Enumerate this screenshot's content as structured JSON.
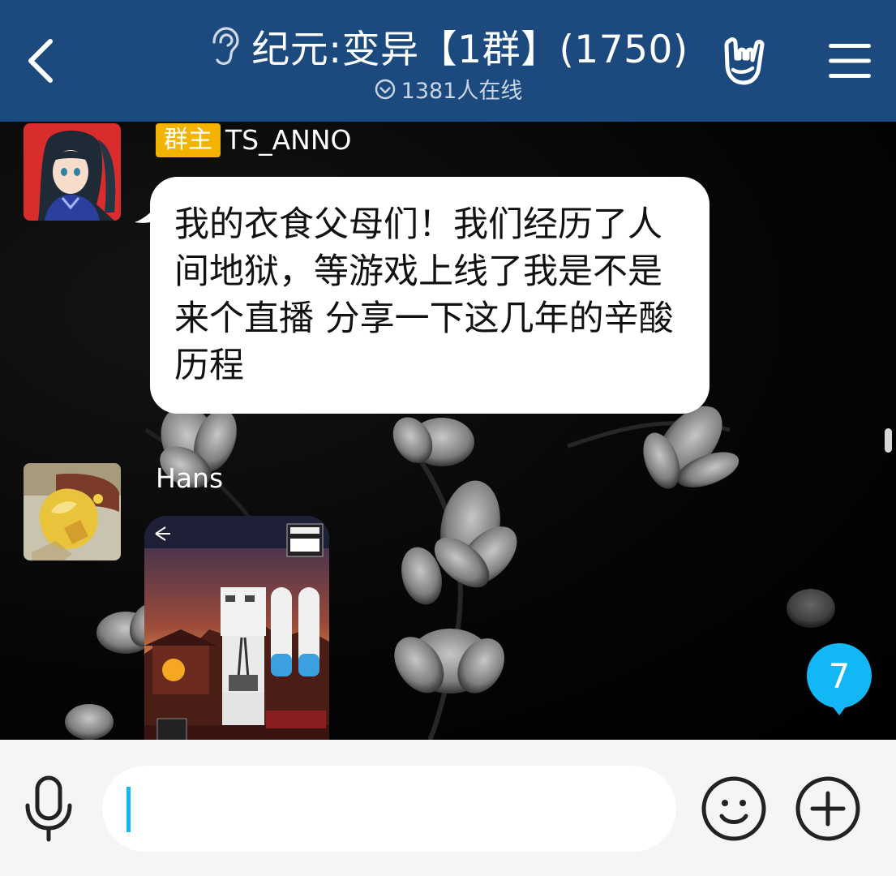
{
  "header": {
    "title": "纪元:变异【1群】(1750)",
    "online_text": "1381人在线",
    "bg_color": "#1c4a7e"
  },
  "messages": [
    {
      "role_badge": "群主",
      "sender": "TS_ANNO",
      "type": "text",
      "text": "我的衣食父母们！我们经历了人间地狱，等游戏上线了我是不是来个直播 分享一下这几年的辛酸历程"
    },
    {
      "sender": "Hans",
      "type": "image"
    }
  ],
  "unread_badge": {
    "count": "7",
    "color": "#12b7f5"
  },
  "input_bar": {
    "placeholder": "",
    "value": "",
    "accent_color": "#12b7f5"
  },
  "icons": {
    "back": "chevron-left-icon",
    "ear": "ear-icon",
    "online": "check-circle-icon",
    "hand": "rock-hand-icon",
    "menu": "hamburger-menu-icon",
    "mic": "microphone-icon",
    "emoji": "smiley-face-icon",
    "plus": "plus-circle-icon"
  }
}
